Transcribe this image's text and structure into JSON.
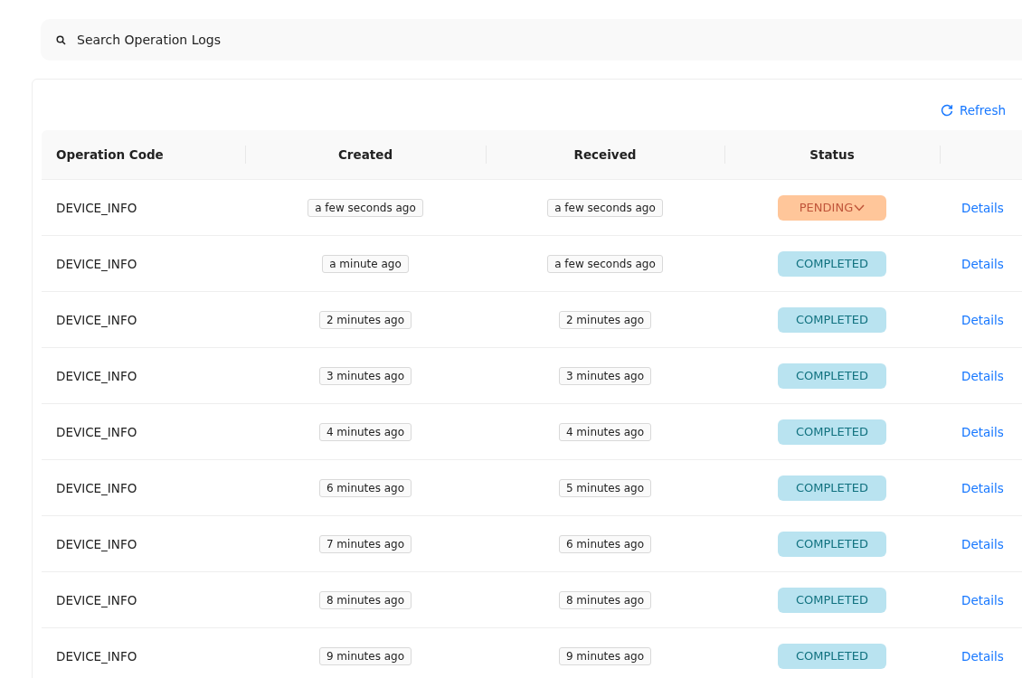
{
  "search": {
    "placeholder": "Search Operation Logs"
  },
  "refresh_button": {
    "label": "Refresh"
  },
  "table": {
    "columns": [
      "Operation Code",
      "Created",
      "Received",
      "Status"
    ],
    "rows": [
      {
        "code": "DEVICE_INFO",
        "created": "a few seconds ago",
        "received": "a few seconds ago",
        "status": "PENDING",
        "kind": "pending",
        "action": "Details"
      },
      {
        "code": "DEVICE_INFO",
        "created": "a minute ago",
        "received": "a few seconds ago",
        "status": "COMPLETED",
        "kind": "completed",
        "action": "Details"
      },
      {
        "code": "DEVICE_INFO",
        "created": "2 minutes ago",
        "received": "2 minutes ago",
        "status": "COMPLETED",
        "kind": "completed",
        "action": "Details"
      },
      {
        "code": "DEVICE_INFO",
        "created": "3 minutes ago",
        "received": "3 minutes ago",
        "status": "COMPLETED",
        "kind": "completed",
        "action": "Details"
      },
      {
        "code": "DEVICE_INFO",
        "created": "4 minutes ago",
        "received": "4 minutes ago",
        "status": "COMPLETED",
        "kind": "completed",
        "action": "Details"
      },
      {
        "code": "DEVICE_INFO",
        "created": "6 minutes ago",
        "received": "5 minutes ago",
        "status": "COMPLETED",
        "kind": "completed",
        "action": "Details"
      },
      {
        "code": "DEVICE_INFO",
        "created": "7 minutes ago",
        "received": "6 minutes ago",
        "status": "COMPLETED",
        "kind": "completed",
        "action": "Details"
      },
      {
        "code": "DEVICE_INFO",
        "created": "8 minutes ago",
        "received": "8 minutes ago",
        "status": "COMPLETED",
        "kind": "completed",
        "action": "Details"
      },
      {
        "code": "DEVICE_INFO",
        "created": "9 minutes ago",
        "received": "9 minutes ago",
        "status": "COMPLETED",
        "kind": "completed",
        "action": "Details"
      }
    ]
  }
}
